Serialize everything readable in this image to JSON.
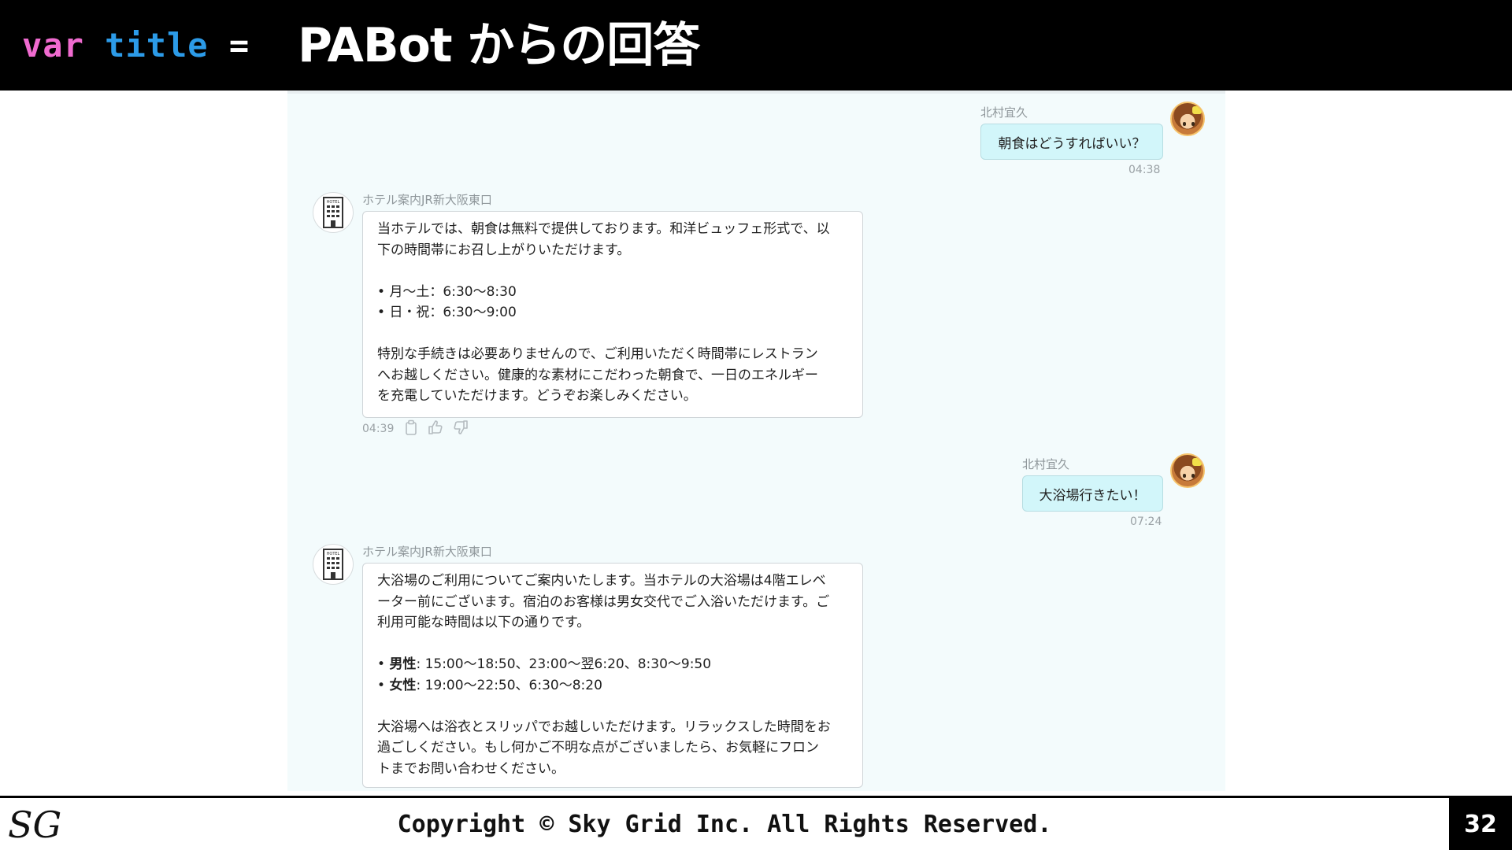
{
  "header": {
    "code_var": "var",
    "code_title": "title",
    "code_eq": "=",
    "slide_title": "PABot からの回答"
  },
  "chat": {
    "messages": [
      {
        "role": "user",
        "sender": "北村宜久",
        "text": "朝食はどうすればいい？",
        "time": "04:38",
        "avatar": "anime-girl-avatar"
      },
      {
        "role": "bot",
        "sender": "ホテル案内JR新大阪東口",
        "time": "04:39",
        "avatar": "hotel-building-icon",
        "para1_line1": "当ホテルでは、朝食は無料で提供しております。和洋ビュッフェ形式で、以",
        "para1_line2": "下の時間帯にお召し上がりいただけます。",
        "bullet1": "月〜土：6:30〜8:30",
        "bullet2": "日・祝：6:30〜9:00",
        "para2_line1": "特別な手続きは必要ありませんので、ご利用いただく時間帯にレストラン",
        "para2_line2": "へお越しください。健康的な素材にこだわった朝食で、一日のエネルギー",
        "para2_line3": "を充電していただけます。どうぞお楽しみください。"
      },
      {
        "role": "user",
        "sender": "北村宜久",
        "text": "大浴場行きたい！",
        "time": "07:24",
        "avatar": "anime-girl-avatar"
      },
      {
        "role": "bot",
        "sender": "ホテル案内JR新大阪東口",
        "avatar": "hotel-building-icon",
        "para1_line1": "大浴場のご利用についてご案内いたします。当ホテルの大浴場は4階エレベ",
        "para1_line2": "ーター前にございます。宿泊のお客様は男女交代でご入浴いただけます。ご",
        "para1_line3": "利用可能な時間は以下の通りです。",
        "bullet1_label": "男性",
        "bullet1_text": ": 15:00〜18:50、23:00〜翌6:20、8:30〜9:50",
        "bullet2_label": "女性",
        "bullet2_text": ": 19:00〜22:50、6:30〜8:20",
        "para2_line1": "大浴場へは浴衣とスリッパでお越しいただけます。リラックスした時間をお",
        "para2_line2": "過ごしください。もし何かご不明な点がございましたら、お気軽にフロン",
        "para2_line3": "トまでお問い合わせください。"
      }
    ],
    "action_icons": [
      "copy-icon",
      "thumbs-up-icon",
      "thumbs-down-icon"
    ],
    "hotel_icon_label": "HOTEL"
  },
  "footer": {
    "logo_text": "SG",
    "copyright": "Copyright © Sky Grid Inc. All Rights Reserved.",
    "page_number": "32"
  },
  "colors": {
    "header_bg": "#000000",
    "code_var": "#f06bd0",
    "code_title": "#2c9be8",
    "chat_bg": "#f3fbfc",
    "user_bubble": "#d2f6fa",
    "bot_bubble": "#ffffff"
  }
}
